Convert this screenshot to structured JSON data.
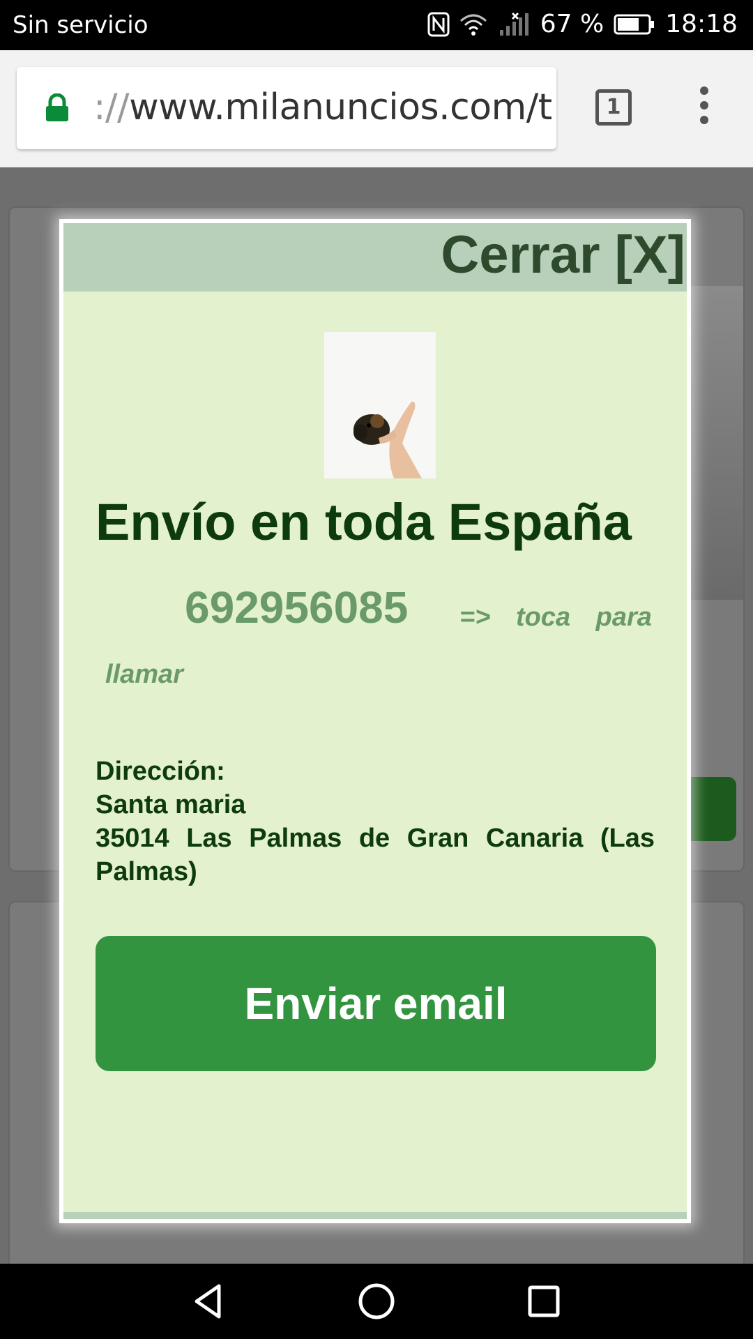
{
  "status_bar": {
    "carrier": "Sin servicio",
    "battery_percent": "67 %",
    "time": "18:18",
    "icons": [
      "nfc-icon",
      "wifi-icon",
      "signal-icon",
      "battery-icon"
    ]
  },
  "browser": {
    "url_scheme": "://",
    "url_host": "www.milanuncios.com/t",
    "tab_count": "1",
    "icons": [
      "lock-icon",
      "overflow-menu-icon"
    ]
  },
  "modal": {
    "close_label": "Cerrar [X]",
    "title": "Envío en toda España",
    "phone": "692956085",
    "call_hint": "=> toca para",
    "call_hint_2": "llamar",
    "address_label": "Dirección:",
    "address_line1": "Santa maria",
    "address_line2": "35014 Las Palmas de Gran Canaria (Las Palmas)",
    "email_button": "Enviar email",
    "colors": {
      "background": "#e3f1cf",
      "header": "#b8cfba",
      "title": "#0e3b0e",
      "phone": "#6a9a6a",
      "button": "#339440"
    }
  },
  "nav_bar": {
    "icons": [
      "back-icon",
      "home-icon",
      "recents-icon"
    ]
  }
}
